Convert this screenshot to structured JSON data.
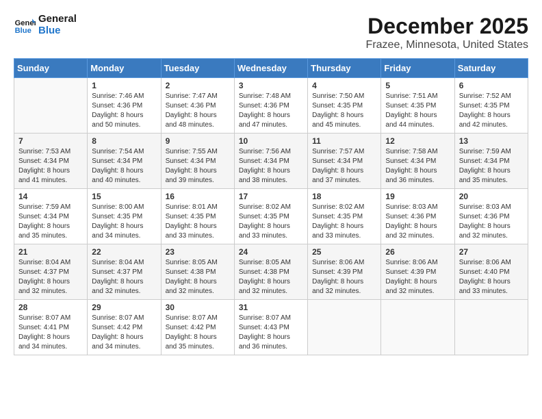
{
  "header": {
    "logo_line1": "General",
    "logo_line2": "Blue",
    "month": "December 2025",
    "location": "Frazee, Minnesota, United States"
  },
  "weekdays": [
    "Sunday",
    "Monday",
    "Tuesday",
    "Wednesday",
    "Thursday",
    "Friday",
    "Saturday"
  ],
  "weeks": [
    [
      {
        "day": "",
        "sunrise": "",
        "sunset": "",
        "daylight": ""
      },
      {
        "day": "1",
        "sunrise": "Sunrise: 7:46 AM",
        "sunset": "Sunset: 4:36 PM",
        "daylight": "Daylight: 8 hours and 50 minutes."
      },
      {
        "day": "2",
        "sunrise": "Sunrise: 7:47 AM",
        "sunset": "Sunset: 4:36 PM",
        "daylight": "Daylight: 8 hours and 48 minutes."
      },
      {
        "day": "3",
        "sunrise": "Sunrise: 7:48 AM",
        "sunset": "Sunset: 4:36 PM",
        "daylight": "Daylight: 8 hours and 47 minutes."
      },
      {
        "day": "4",
        "sunrise": "Sunrise: 7:50 AM",
        "sunset": "Sunset: 4:35 PM",
        "daylight": "Daylight: 8 hours and 45 minutes."
      },
      {
        "day": "5",
        "sunrise": "Sunrise: 7:51 AM",
        "sunset": "Sunset: 4:35 PM",
        "daylight": "Daylight: 8 hours and 44 minutes."
      },
      {
        "day": "6",
        "sunrise": "Sunrise: 7:52 AM",
        "sunset": "Sunset: 4:35 PM",
        "daylight": "Daylight: 8 hours and 42 minutes."
      }
    ],
    [
      {
        "day": "7",
        "sunrise": "Sunrise: 7:53 AM",
        "sunset": "Sunset: 4:34 PM",
        "daylight": "Daylight: 8 hours and 41 minutes."
      },
      {
        "day": "8",
        "sunrise": "Sunrise: 7:54 AM",
        "sunset": "Sunset: 4:34 PM",
        "daylight": "Daylight: 8 hours and 40 minutes."
      },
      {
        "day": "9",
        "sunrise": "Sunrise: 7:55 AM",
        "sunset": "Sunset: 4:34 PM",
        "daylight": "Daylight: 8 hours and 39 minutes."
      },
      {
        "day": "10",
        "sunrise": "Sunrise: 7:56 AM",
        "sunset": "Sunset: 4:34 PM",
        "daylight": "Daylight: 8 hours and 38 minutes."
      },
      {
        "day": "11",
        "sunrise": "Sunrise: 7:57 AM",
        "sunset": "Sunset: 4:34 PM",
        "daylight": "Daylight: 8 hours and 37 minutes."
      },
      {
        "day": "12",
        "sunrise": "Sunrise: 7:58 AM",
        "sunset": "Sunset: 4:34 PM",
        "daylight": "Daylight: 8 hours and 36 minutes."
      },
      {
        "day": "13",
        "sunrise": "Sunrise: 7:59 AM",
        "sunset": "Sunset: 4:34 PM",
        "daylight": "Daylight: 8 hours and 35 minutes."
      }
    ],
    [
      {
        "day": "14",
        "sunrise": "Sunrise: 7:59 AM",
        "sunset": "Sunset: 4:34 PM",
        "daylight": "Daylight: 8 hours and 35 minutes."
      },
      {
        "day": "15",
        "sunrise": "Sunrise: 8:00 AM",
        "sunset": "Sunset: 4:35 PM",
        "daylight": "Daylight: 8 hours and 34 minutes."
      },
      {
        "day": "16",
        "sunrise": "Sunrise: 8:01 AM",
        "sunset": "Sunset: 4:35 PM",
        "daylight": "Daylight: 8 hours and 33 minutes."
      },
      {
        "day": "17",
        "sunrise": "Sunrise: 8:02 AM",
        "sunset": "Sunset: 4:35 PM",
        "daylight": "Daylight: 8 hours and 33 minutes."
      },
      {
        "day": "18",
        "sunrise": "Sunrise: 8:02 AM",
        "sunset": "Sunset: 4:35 PM",
        "daylight": "Daylight: 8 hours and 33 minutes."
      },
      {
        "day": "19",
        "sunrise": "Sunrise: 8:03 AM",
        "sunset": "Sunset: 4:36 PM",
        "daylight": "Daylight: 8 hours and 32 minutes."
      },
      {
        "day": "20",
        "sunrise": "Sunrise: 8:03 AM",
        "sunset": "Sunset: 4:36 PM",
        "daylight": "Daylight: 8 hours and 32 minutes."
      }
    ],
    [
      {
        "day": "21",
        "sunrise": "Sunrise: 8:04 AM",
        "sunset": "Sunset: 4:37 PM",
        "daylight": "Daylight: 8 hours and 32 minutes."
      },
      {
        "day": "22",
        "sunrise": "Sunrise: 8:04 AM",
        "sunset": "Sunset: 4:37 PM",
        "daylight": "Daylight: 8 hours and 32 minutes."
      },
      {
        "day": "23",
        "sunrise": "Sunrise: 8:05 AM",
        "sunset": "Sunset: 4:38 PM",
        "daylight": "Daylight: 8 hours and 32 minutes."
      },
      {
        "day": "24",
        "sunrise": "Sunrise: 8:05 AM",
        "sunset": "Sunset: 4:38 PM",
        "daylight": "Daylight: 8 hours and 32 minutes."
      },
      {
        "day": "25",
        "sunrise": "Sunrise: 8:06 AM",
        "sunset": "Sunset: 4:39 PM",
        "daylight": "Daylight: 8 hours and 32 minutes."
      },
      {
        "day": "26",
        "sunrise": "Sunrise: 8:06 AM",
        "sunset": "Sunset: 4:39 PM",
        "daylight": "Daylight: 8 hours and 32 minutes."
      },
      {
        "day": "27",
        "sunrise": "Sunrise: 8:06 AM",
        "sunset": "Sunset: 4:40 PM",
        "daylight": "Daylight: 8 hours and 33 minutes."
      }
    ],
    [
      {
        "day": "28",
        "sunrise": "Sunrise: 8:07 AM",
        "sunset": "Sunset: 4:41 PM",
        "daylight": "Daylight: 8 hours and 34 minutes."
      },
      {
        "day": "29",
        "sunrise": "Sunrise: 8:07 AM",
        "sunset": "Sunset: 4:42 PM",
        "daylight": "Daylight: 8 hours and 34 minutes."
      },
      {
        "day": "30",
        "sunrise": "Sunrise: 8:07 AM",
        "sunset": "Sunset: 4:42 PM",
        "daylight": "Daylight: 8 hours and 35 minutes."
      },
      {
        "day": "31",
        "sunrise": "Sunrise: 8:07 AM",
        "sunset": "Sunset: 4:43 PM",
        "daylight": "Daylight: 8 hours and 36 minutes."
      },
      {
        "day": "",
        "sunrise": "",
        "sunset": "",
        "daylight": ""
      },
      {
        "day": "",
        "sunrise": "",
        "sunset": "",
        "daylight": ""
      },
      {
        "day": "",
        "sunrise": "",
        "sunset": "",
        "daylight": ""
      }
    ]
  ]
}
